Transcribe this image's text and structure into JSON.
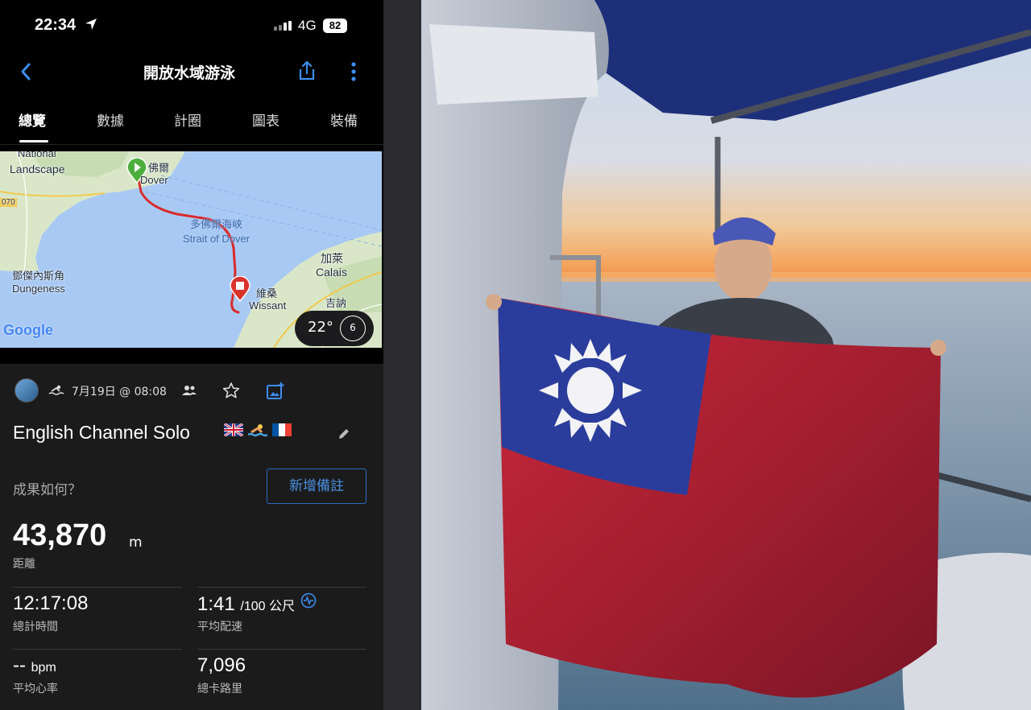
{
  "status_bar": {
    "time": "22:34",
    "network": "4G",
    "battery": "82"
  },
  "nav": {
    "title": "開放水域游泳"
  },
  "tabs": [
    {
      "label": "總覽"
    },
    {
      "label": "數據"
    },
    {
      "label": "計圈"
    },
    {
      "label": "圖表"
    },
    {
      "label": "裝備"
    }
  ],
  "map": {
    "labels": {
      "national": "National",
      "landscape": "Landscape",
      "road": "070",
      "dover_zh": "佛爾",
      "dover_en": "Dover",
      "strait_zh": "多佛爾海峽",
      "strait_en": "Strait of Dover",
      "calais_zh": "加萊",
      "calais_en": "Calais",
      "dungeness_zh": "鄧傑內斯角",
      "dungeness_en": "Dungeness",
      "wissant_zh": "維桑",
      "wissant_en": "Wissant",
      "jixun": "吉訥"
    },
    "logo": "Google",
    "temperature": "22°",
    "wind": "6"
  },
  "activity": {
    "date": "7月19日 @ 08:08",
    "title": "English Channel Solo",
    "how_prompt": "成果如何？",
    "add_note": "新增備註",
    "distance": {
      "value": "43,870",
      "unit": "m",
      "label": "距離"
    },
    "total_time": {
      "value": "12:17:08",
      "label": "總計時間"
    },
    "avg_pace": {
      "value": "1:41",
      "unit": "/100 公尺",
      "label": "平均配速"
    },
    "avg_hr": {
      "value": "--",
      "unit": "bpm",
      "label": "平均心率"
    },
    "calories": {
      "value": "7,096",
      "label": "總卡路里"
    }
  },
  "colors": {
    "accent": "#2c6cc4",
    "route": "#d92b2b",
    "start_pin": "#4caf3c",
    "end_pin": "#d9332b"
  }
}
